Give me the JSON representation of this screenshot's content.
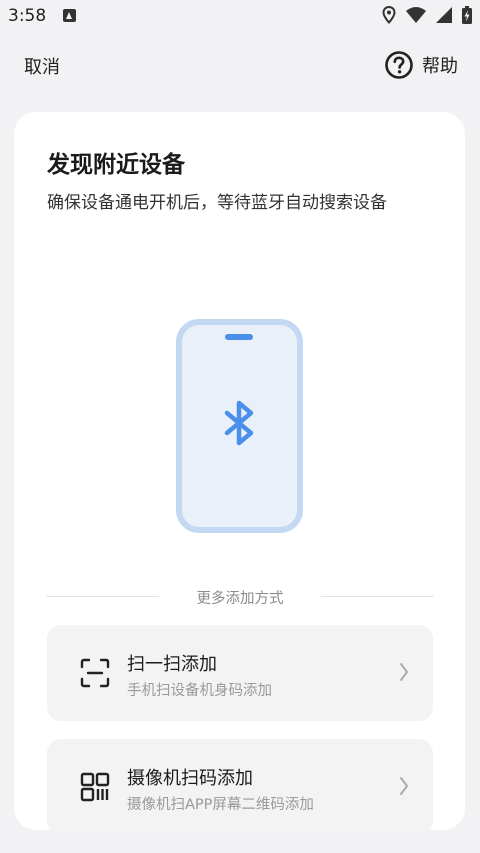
{
  "status_bar": {
    "time": "3:58",
    "icons": [
      "notification-a-icon",
      "location-icon",
      "wifi-icon",
      "signal-icon",
      "battery-icon"
    ]
  },
  "header": {
    "cancel_label": "取消",
    "help_label": "帮助"
  },
  "discovery": {
    "title": "发现附近设备",
    "subtitle": "确保设备通电开机后，等待蓝牙自动搜索设备",
    "illustration_icon": "bluetooth-icon",
    "accent_color": "#4a8fea"
  },
  "more_methods": {
    "label": "更多添加方式",
    "items": [
      {
        "icon": "scan-icon",
        "title": "扫一扫添加",
        "subtitle": "手机扫设备机身码添加"
      },
      {
        "icon": "qr-code-icon",
        "title": "摄像机扫码添加",
        "subtitle": "摄像机扫APP屏幕二维码添加"
      }
    ]
  }
}
